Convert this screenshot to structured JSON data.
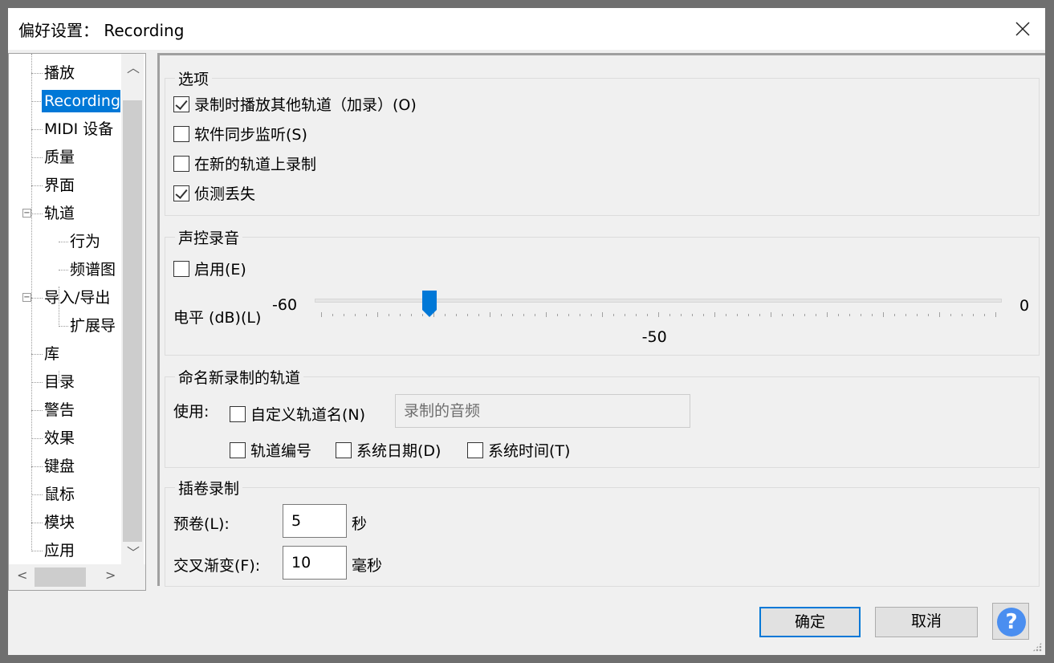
{
  "window": {
    "title": "偏好设置： Recording"
  },
  "tree": {
    "items": [
      {
        "label": "播放",
        "level": 1
      },
      {
        "label": "Recording",
        "level": 1,
        "selected": true
      },
      {
        "label": "MIDI 设备",
        "level": 1
      },
      {
        "label": "质量",
        "level": 1
      },
      {
        "label": "界面",
        "level": 1
      },
      {
        "label": "轨道",
        "level": 1,
        "expanded": true
      },
      {
        "label": "行为",
        "level": 2
      },
      {
        "label": "频谱图",
        "level": 2
      },
      {
        "label": "导入/导出",
        "level": 1,
        "expanded": true
      },
      {
        "label": "扩展导",
        "level": 2
      },
      {
        "label": "库",
        "level": 1
      },
      {
        "label": "目录",
        "level": 1
      },
      {
        "label": "警告",
        "level": 1
      },
      {
        "label": "效果",
        "level": 1
      },
      {
        "label": "键盘",
        "level": 1
      },
      {
        "label": "鼠标",
        "level": 1
      },
      {
        "label": "模块",
        "level": 1
      },
      {
        "label": "应用",
        "level": 1
      }
    ]
  },
  "options": {
    "title": "选项",
    "checks": [
      {
        "label": "录制时播放其他轨道（加录）(O)",
        "checked": true
      },
      {
        "label": "软件同步监听(S)",
        "checked": false
      },
      {
        "label": "在新的轨道上录制",
        "checked": false
      },
      {
        "label": "侦测丢失",
        "checked": true
      }
    ]
  },
  "voice": {
    "title": "声控录音",
    "enable_label": "启用(E)",
    "enable_checked": false,
    "level_label": "电平 (dB)(L)",
    "min_label": "-60",
    "max_label": "0",
    "min": -60,
    "max": 0,
    "value": -50,
    "value_label": "-50",
    "accent": "#0078d7"
  },
  "naming": {
    "title": "命名新录制的轨道",
    "use_label": "使用:",
    "custom_label": "自定义轨道名(N)",
    "custom_checked": false,
    "custom_value": "录制的音频",
    "track_number": "轨道编号",
    "system_date": "系统日期(D)",
    "system_time": "系统时间(T)"
  },
  "punch": {
    "title": "插卷录制",
    "preroll_label": "预卷(L):",
    "preroll_value": "5",
    "preroll_unit": "秒",
    "crossfade_label": "交叉渐变(F):",
    "crossfade_value": "10",
    "crossfade_unit": "毫秒"
  },
  "buttons": {
    "ok": "确定",
    "cancel": "取消",
    "help": "?"
  }
}
